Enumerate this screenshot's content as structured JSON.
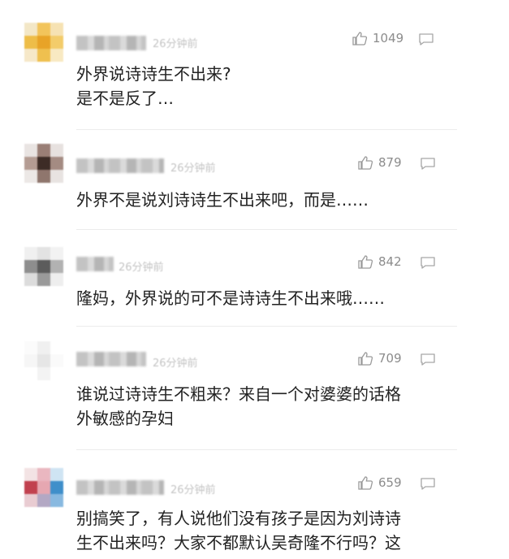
{
  "comments": [
    {
      "time": "26分钟前",
      "likes": "1049",
      "text": "外界说诗诗生不出来?\n是不是反了…",
      "avatar_colors": [
        "#f3e7c6",
        "#f2c45b",
        "#f6e2b3",
        "#eebd48",
        "#e8a327",
        "#f3cc6a",
        "#f6e8c8",
        "#efc04f",
        "#f8e9c2"
      ]
    },
    {
      "time": "26分钟前",
      "likes": "879",
      "text": "外界不是说刘诗诗生不出来吧，而是……",
      "avatar_colors": [
        "#e9e4e2",
        "#9a7f76",
        "#e7e1df",
        "#b49c93",
        "#3d2c26",
        "#a48b82",
        "#ece8e6",
        "#8f766d",
        "#e8e3e1"
      ]
    },
    {
      "time": "26分钟前",
      "likes": "842",
      "text": "隆妈，外界说的可不是诗诗生不出来哦……",
      "avatar_colors": [
        "#f0f0f0",
        "#e3e3e3",
        "#f2f2f2",
        "#8e8e8e",
        "#5c5c5c",
        "#b2b2b2",
        "#dcdcdc",
        "#9a9a9a",
        "#eeeeee"
      ]
    },
    {
      "time": "26分钟前",
      "likes": "709",
      "text": "谁说过诗诗生不粗来？来自一个对婆婆的话格\n外敏感的孕妇",
      "avatar_colors": [
        "#fbfbfb",
        "#f0f0f0",
        "#ffffff",
        "#f6f6f6",
        "#e6e6e6",
        "#fafafa",
        "#ffffff",
        "#f3f3f3",
        "#ffffff"
      ]
    },
    {
      "time": "26分钟前",
      "likes": "659",
      "text": "别搞笑了，有人说他们没有孩子是因为刘诗诗\n生不出来吗？大家不都默认吴奇隆不行吗？这",
      "avatar_colors": [
        "#f3e3e4",
        "#eab7c0",
        "#cfe4f3",
        "#c1414f",
        "#e6a7b1",
        "#3f8fca",
        "#e9ccd2",
        "#b3a8c4",
        "#88b9e0"
      ]
    }
  ]
}
